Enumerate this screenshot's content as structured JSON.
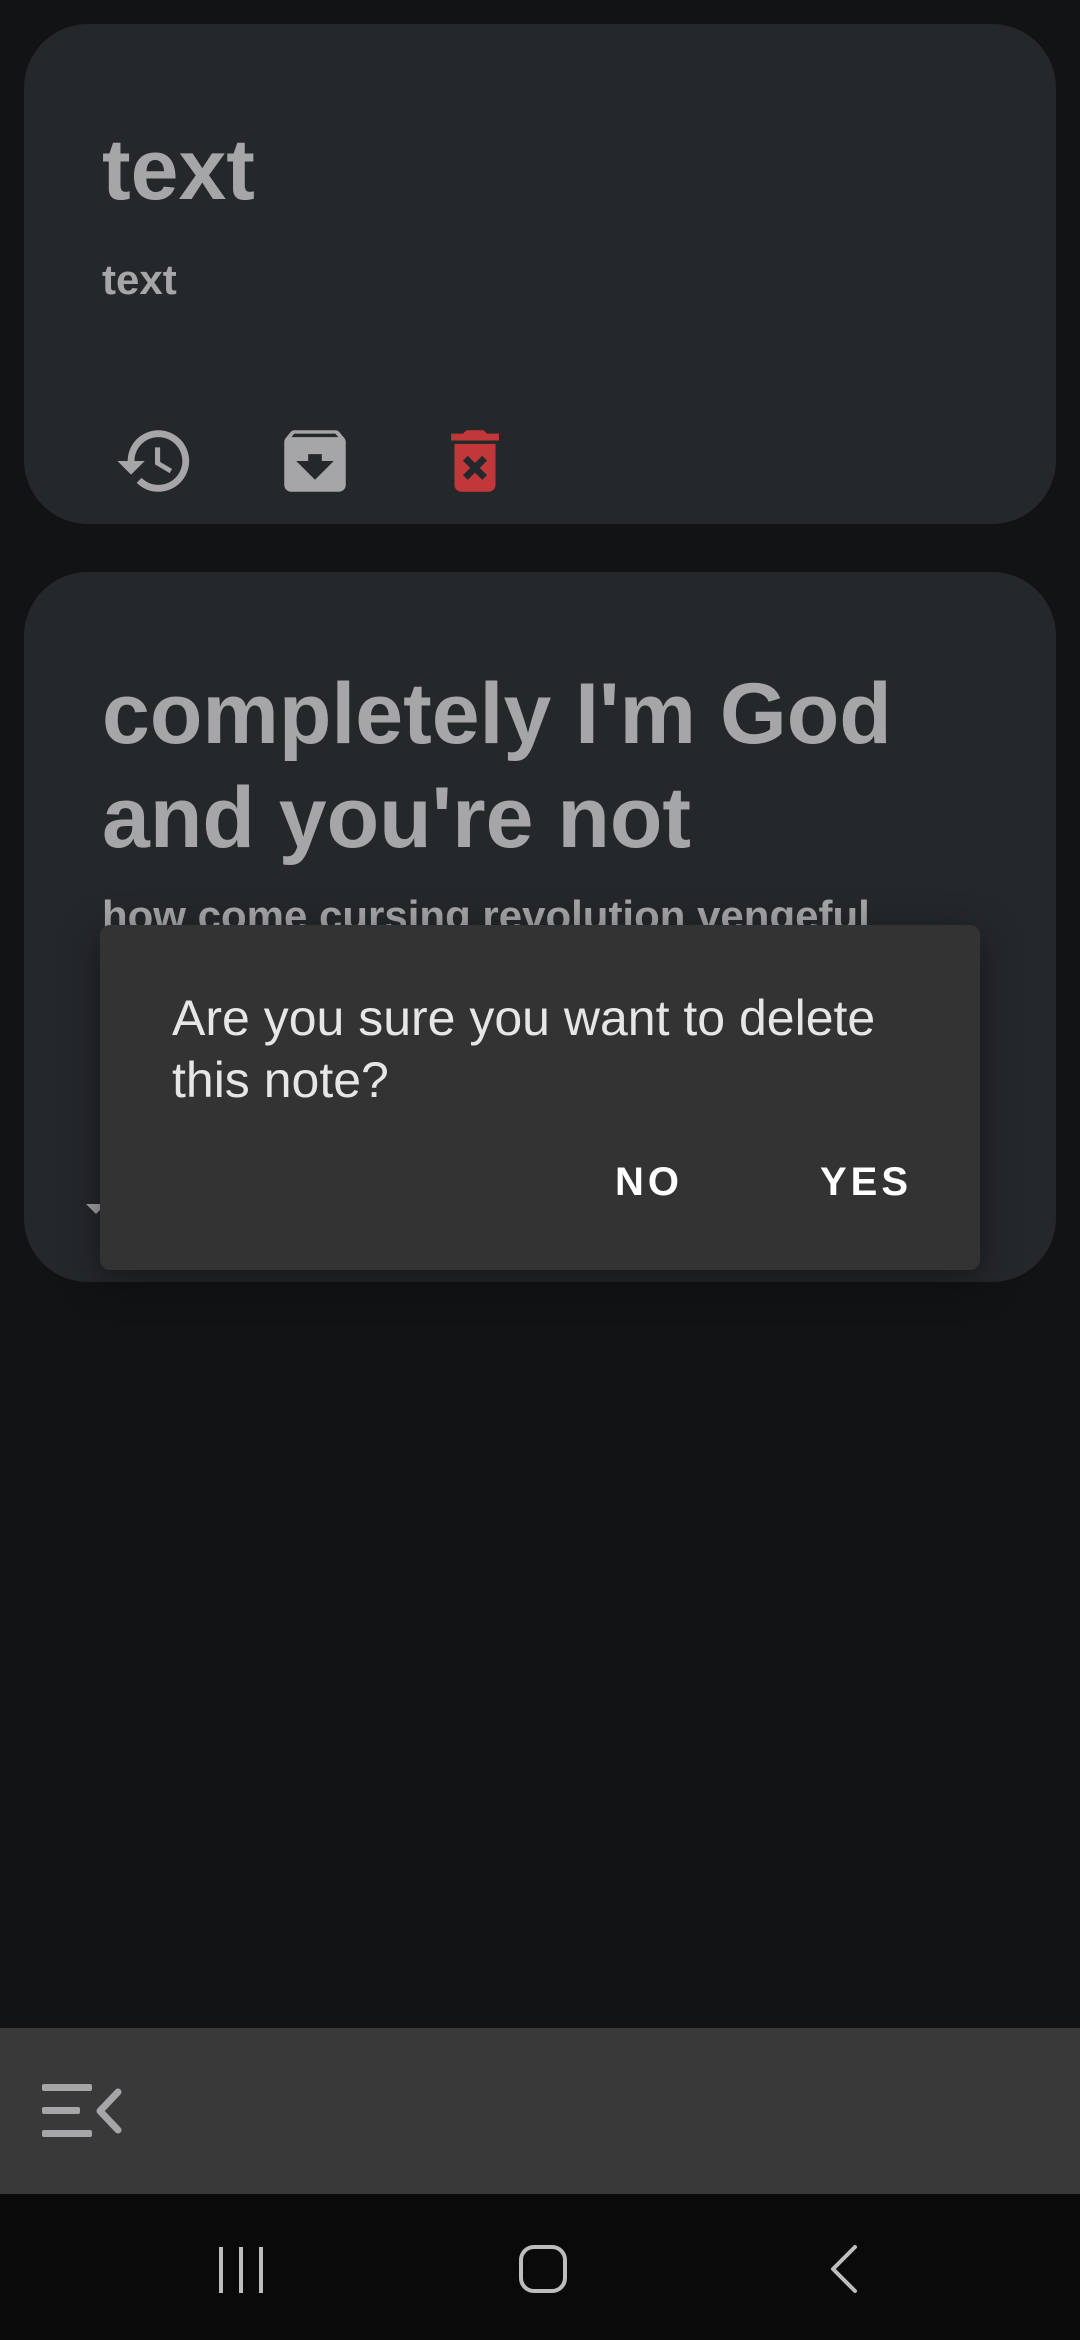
{
  "notes": [
    {
      "title": "text",
      "subtitle": "text",
      "actions": [
        {
          "icon": "restore-history-icon"
        },
        {
          "icon": "archive-icon"
        },
        {
          "icon": "delete-icon",
          "color": "#c2383a"
        }
      ]
    },
    {
      "title": "completely I'm God and you're not",
      "body": "how come cursing revolution vengeful"
    }
  ],
  "dialog": {
    "message": "Are you sure you want to delete this note?",
    "no_label": "NO",
    "yes_label": "YES"
  },
  "bottom_bar": {
    "menu_icon": "menu-collapse-icon"
  },
  "nav": {
    "recents_icon": "recents-icon",
    "home_icon": "home-icon",
    "back_icon": "back-icon"
  },
  "colors": {
    "background": "#121315",
    "card": "#25282b",
    "dialog": "#333333",
    "delete": "#c2383a",
    "text_muted": "#a6a6a8"
  }
}
